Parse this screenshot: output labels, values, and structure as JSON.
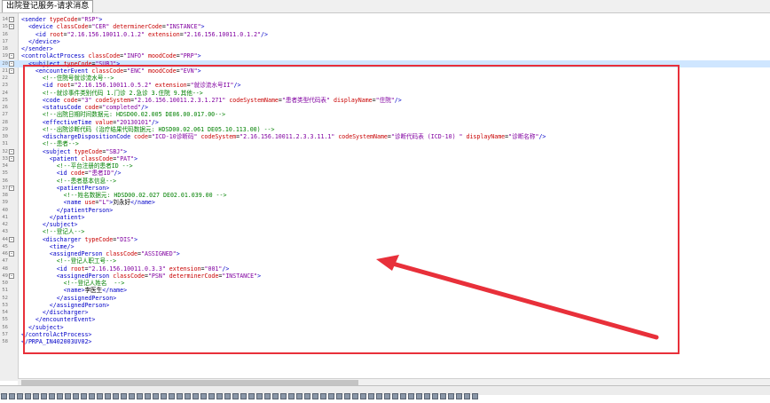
{
  "tab": {
    "label": "出院登记服务-请求消息"
  },
  "lines": [
    {
      "n": "14",
      "fold": "-",
      "tokens": [
        [
          "t",
          "<sender "
        ],
        [
          "a",
          "typeCode"
        ],
        [
          "x",
          "="
        ],
        [
          "v",
          "\"RSP\""
        ],
        [
          "t",
          ">"
        ]
      ]
    },
    {
      "n": "15",
      "fold": "-",
      "tokens": [
        [
          "x",
          "  "
        ],
        [
          "t",
          "<device "
        ],
        [
          "a",
          "classCode"
        ],
        [
          "x",
          "="
        ],
        [
          "v",
          "\"CER\""
        ],
        [
          "x",
          " "
        ],
        [
          "a",
          "determinerCode"
        ],
        [
          "x",
          "="
        ],
        [
          "v",
          "\"INSTANCE\""
        ],
        [
          "t",
          ">"
        ]
      ]
    },
    {
      "n": "16",
      "fold": "",
      "tokens": [
        [
          "x",
          "    "
        ],
        [
          "t",
          "<id "
        ],
        [
          "a",
          "root"
        ],
        [
          "x",
          "="
        ],
        [
          "v",
          "\"2.16.156.10011.0.1.2\""
        ],
        [
          "x",
          " "
        ],
        [
          "a",
          "extension"
        ],
        [
          "x",
          "="
        ],
        [
          "v",
          "\"2.16.156.10011.0.1.2\""
        ],
        [
          "t",
          "/>"
        ]
      ]
    },
    {
      "n": "17",
      "fold": "",
      "tokens": [
        [
          "x",
          "  "
        ],
        [
          "t",
          "</device>"
        ]
      ]
    },
    {
      "n": "18",
      "fold": "",
      "tokens": [
        [
          "t",
          "</sender>"
        ]
      ]
    },
    {
      "n": "19",
      "fold": "-",
      "tokens": [
        [
          "t",
          "<controlActProcess "
        ],
        [
          "a",
          "classCode"
        ],
        [
          "x",
          "="
        ],
        [
          "v",
          "\"INFO\""
        ],
        [
          "x",
          " "
        ],
        [
          "a",
          "moodCode"
        ],
        [
          "x",
          "="
        ],
        [
          "v",
          "\"PRP\""
        ],
        [
          "t",
          ">"
        ]
      ]
    },
    {
      "n": "20",
      "fold": "-",
      "hl": true,
      "tokens": [
        [
          "x",
          "  "
        ],
        [
          "t",
          "<subj"
        ],
        [
          "caret",
          "|"
        ],
        [
          "t",
          "ect "
        ],
        [
          "a",
          "typeCode"
        ],
        [
          "x",
          "="
        ],
        [
          "v",
          "\"SUBJ\""
        ],
        [
          "t",
          ">"
        ]
      ]
    },
    {
      "n": "21",
      "fold": "-",
      "tokens": [
        [
          "x",
          "    "
        ],
        [
          "t",
          "<encounterEvent "
        ],
        [
          "a",
          "classCode"
        ],
        [
          "x",
          "="
        ],
        [
          "v",
          "\"ENC\""
        ],
        [
          "x",
          " "
        ],
        [
          "a",
          "moodCode"
        ],
        [
          "x",
          "="
        ],
        [
          "v",
          "\"EVN\""
        ],
        [
          "t",
          ">"
        ]
      ]
    },
    {
      "n": "22",
      "fold": "",
      "tokens": [
        [
          "c",
          "      <!--住院号就诊流水号-->"
        ]
      ]
    },
    {
      "n": "23",
      "fold": "",
      "tokens": [
        [
          "x",
          "      "
        ],
        [
          "t",
          "<id "
        ],
        [
          "a",
          "root"
        ],
        [
          "x",
          "="
        ],
        [
          "v",
          "\"2.16.156.10011.0.5.2\""
        ],
        [
          "x",
          " "
        ],
        [
          "a",
          "extension"
        ],
        [
          "x",
          "="
        ],
        [
          "v",
          "\"就诊流水号II\""
        ],
        [
          "t",
          "/>"
        ]
      ]
    },
    {
      "n": "24",
      "fold": "",
      "tokens": [
        [
          "c",
          "      <!--就诊事件类别代码 1.门诊 2.急诊 3.住院 9.其他-->"
        ]
      ]
    },
    {
      "n": "25",
      "fold": "",
      "tokens": [
        [
          "x",
          "      "
        ],
        [
          "t",
          "<code "
        ],
        [
          "a",
          "code"
        ],
        [
          "x",
          "="
        ],
        [
          "v",
          "\"3\""
        ],
        [
          "x",
          " "
        ],
        [
          "a",
          "codeSystem"
        ],
        [
          "x",
          "="
        ],
        [
          "v",
          "\"2.16.156.10011.2.3.1.271\""
        ],
        [
          "x",
          " "
        ],
        [
          "a",
          "codeSystemName"
        ],
        [
          "x",
          "="
        ],
        [
          "v",
          "\"患者类型代码表\""
        ],
        [
          "x",
          " "
        ],
        [
          "a",
          "displayName"
        ],
        [
          "x",
          "="
        ],
        [
          "v",
          "\"住院\""
        ],
        [
          "t",
          "/>"
        ]
      ]
    },
    {
      "n": "26",
      "fold": "",
      "tokens": [
        [
          "x",
          "      "
        ],
        [
          "t",
          "<statusCode "
        ],
        [
          "a",
          "code"
        ],
        [
          "x",
          "="
        ],
        [
          "v",
          "\"completed\""
        ],
        [
          "t",
          "/>"
        ]
      ]
    },
    {
      "n": "27",
      "fold": "",
      "tokens": [
        [
          "c",
          "      <!--出院日期时间数据元: HDSD00.02.005 DE06.00.017.00-->"
        ]
      ]
    },
    {
      "n": "28",
      "fold": "",
      "tokens": [
        [
          "x",
          "      "
        ],
        [
          "t",
          "<effectiveTime "
        ],
        [
          "a",
          "value"
        ],
        [
          "x",
          "="
        ],
        [
          "v",
          "\"20130101\""
        ],
        [
          "t",
          "/>"
        ]
      ]
    },
    {
      "n": "29",
      "fold": "",
      "tokens": [
        [
          "c",
          "      <!--出院诊断代码 (治疗结果代码数据元: HDSD00.02.061 DE05.10.113.00) -->"
        ]
      ]
    },
    {
      "n": "30",
      "fold": "",
      "tokens": [
        [
          "x",
          "      "
        ],
        [
          "t",
          "<dischargeDispositionCode "
        ],
        [
          "a",
          "code"
        ],
        [
          "x",
          "="
        ],
        [
          "v",
          "\"ICD-10诊断码\""
        ],
        [
          "x",
          " "
        ],
        [
          "a",
          "codeSystem"
        ],
        [
          "x",
          "="
        ],
        [
          "v",
          "\"2.16.156.10011.2.3.3.11.1\""
        ],
        [
          "x",
          " "
        ],
        [
          "a",
          "codeSystemName"
        ],
        [
          "x",
          "="
        ],
        [
          "v",
          "\"诊断代码表 (ICD-10) \""
        ],
        [
          "x",
          " "
        ],
        [
          "a",
          "displayName"
        ],
        [
          "x",
          "="
        ],
        [
          "v",
          "\"诊断名称\""
        ],
        [
          "t",
          "/>"
        ]
      ]
    },
    {
      "n": "31",
      "fold": "",
      "tokens": [
        [
          "c",
          "      <!--患者-->"
        ]
      ]
    },
    {
      "n": "32",
      "fold": "-",
      "tokens": [
        [
          "x",
          "      "
        ],
        [
          "t",
          "<subject "
        ],
        [
          "a",
          "typeCode"
        ],
        [
          "x",
          "="
        ],
        [
          "v",
          "\"SBJ\""
        ],
        [
          "t",
          ">"
        ]
      ]
    },
    {
      "n": "33",
      "fold": "-",
      "tokens": [
        [
          "x",
          "        "
        ],
        [
          "t",
          "<patient "
        ],
        [
          "a",
          "classCode"
        ],
        [
          "x",
          "="
        ],
        [
          "v",
          "\"PAT\""
        ],
        [
          "t",
          ">"
        ]
      ]
    },
    {
      "n": "34",
      "fold": "",
      "tokens": [
        [
          "c",
          "          <!--平台注册的患者ID -->"
        ]
      ]
    },
    {
      "n": "35",
      "fold": "",
      "tokens": [
        [
          "x",
          "          "
        ],
        [
          "t",
          "<id "
        ],
        [
          "a",
          "code"
        ],
        [
          "x",
          "="
        ],
        [
          "v",
          "\"患者ID\""
        ],
        [
          "t",
          "/>"
        ]
      ]
    },
    {
      "n": "36",
      "fold": "",
      "tokens": [
        [
          "c",
          "          <!--患者基本信息-->"
        ]
      ]
    },
    {
      "n": "37",
      "fold": "-",
      "tokens": [
        [
          "x",
          "          "
        ],
        [
          "t",
          "<patientPerson>"
        ]
      ]
    },
    {
      "n": "38",
      "fold": "",
      "tokens": [
        [
          "c",
          "            <!--姓名数据元: HDSD00.02.027 DE02.01.039.00 -->"
        ]
      ]
    },
    {
      "n": "39",
      "fold": "",
      "tokens": [
        [
          "x",
          "            "
        ],
        [
          "t",
          "<name "
        ],
        [
          "a",
          "use"
        ],
        [
          "x",
          "="
        ],
        [
          "v",
          "\"L\""
        ],
        [
          "t",
          ">"
        ],
        [
          "x",
          "刘永好"
        ],
        [
          "t",
          "</name>"
        ]
      ]
    },
    {
      "n": "40",
      "fold": "",
      "tokens": [
        [
          "x",
          "          "
        ],
        [
          "t",
          "</patientPerson>"
        ]
      ]
    },
    {
      "n": "41",
      "fold": "",
      "tokens": [
        [
          "x",
          "        "
        ],
        [
          "t",
          "</patient>"
        ]
      ]
    },
    {
      "n": "42",
      "fold": "",
      "tokens": [
        [
          "x",
          "      "
        ],
        [
          "t",
          "</subject>"
        ]
      ]
    },
    {
      "n": "43",
      "fold": "",
      "tokens": [
        [
          "c",
          "      <!--登记人-->"
        ]
      ]
    },
    {
      "n": "44",
      "fold": "-",
      "tokens": [
        [
          "x",
          "      "
        ],
        [
          "t",
          "<discharger "
        ],
        [
          "a",
          "typeCode"
        ],
        [
          "x",
          "="
        ],
        [
          "v",
          "\"DIS\""
        ],
        [
          "t",
          ">"
        ]
      ]
    },
    {
      "n": "45",
      "fold": "",
      "tokens": [
        [
          "x",
          "        "
        ],
        [
          "t",
          "<time/>"
        ]
      ]
    },
    {
      "n": "46",
      "fold": "-",
      "tokens": [
        [
          "x",
          "        "
        ],
        [
          "t",
          "<assignedPerson "
        ],
        [
          "a",
          "classCode"
        ],
        [
          "x",
          "="
        ],
        [
          "v",
          "\"ASSIGNED\""
        ],
        [
          "t",
          ">"
        ]
      ]
    },
    {
      "n": "47",
      "fold": "",
      "tokens": [
        [
          "c",
          "          <!--登记人职工号-->"
        ]
      ]
    },
    {
      "n": "48",
      "fold": "",
      "tokens": [
        [
          "x",
          "          "
        ],
        [
          "t",
          "<id "
        ],
        [
          "a",
          "root"
        ],
        [
          "x",
          "="
        ],
        [
          "v",
          "\"2.16.156.10011.0.3.3\""
        ],
        [
          "x",
          " "
        ],
        [
          "a",
          "extension"
        ],
        [
          "x",
          "="
        ],
        [
          "v",
          "\"001\""
        ],
        [
          "t",
          "/>"
        ]
      ]
    },
    {
      "n": "49",
      "fold": "-",
      "tokens": [
        [
          "x",
          "          "
        ],
        [
          "t",
          "<assignedPerson "
        ],
        [
          "a",
          "classCode"
        ],
        [
          "x",
          "="
        ],
        [
          "v",
          "\"PSN\""
        ],
        [
          "x",
          " "
        ],
        [
          "a",
          "determinerCode"
        ],
        [
          "x",
          "="
        ],
        [
          "v",
          "\"INSTANCE\""
        ],
        [
          "t",
          ">"
        ]
      ]
    },
    {
      "n": "50",
      "fold": "",
      "tokens": [
        [
          "c",
          "            <!--登记人姓名  -->"
        ]
      ]
    },
    {
      "n": "51",
      "fold": "",
      "tokens": [
        [
          "x",
          "            "
        ],
        [
          "t",
          "<name>"
        ],
        [
          "x",
          "李医生"
        ],
        [
          "t",
          "</name>"
        ]
      ]
    },
    {
      "n": "52",
      "fold": "",
      "tokens": [
        [
          "x",
          "          "
        ],
        [
          "t",
          "</assignedPerson>"
        ]
      ]
    },
    {
      "n": "53",
      "fold": "",
      "tokens": [
        [
          "x",
          "        "
        ],
        [
          "t",
          "</assignedPerson>"
        ]
      ]
    },
    {
      "n": "54",
      "fold": "",
      "tokens": [
        [
          "x",
          "      "
        ],
        [
          "t",
          "</discharger>"
        ]
      ]
    },
    {
      "n": "55",
      "fold": "",
      "tokens": [
        [
          "x",
          "    "
        ],
        [
          "t",
          "</encounterEvent>"
        ]
      ]
    },
    {
      "n": "56",
      "fold": "",
      "tokens": [
        [
          "x",
          "  "
        ],
        [
          "t",
          "</subject>"
        ]
      ]
    },
    {
      "n": "57",
      "fold": "",
      "tokens": [
        [
          "t",
          "</controlActProcess>"
        ]
      ]
    },
    {
      "n": "58",
      "fold": "",
      "tokens": [
        [
          "t",
          "</PRPA_IN402003UV02>"
        ]
      ]
    }
  ],
  "colors": {
    "tag": "#0000c8",
    "attribute": "#c80000",
    "value": "#8000a0",
    "comment": "#008000",
    "annotation": "#e8303a"
  },
  "icons": [
    "fold-toggle-icon",
    "arrow-annotation-icon",
    "toolbar-icon"
  ]
}
